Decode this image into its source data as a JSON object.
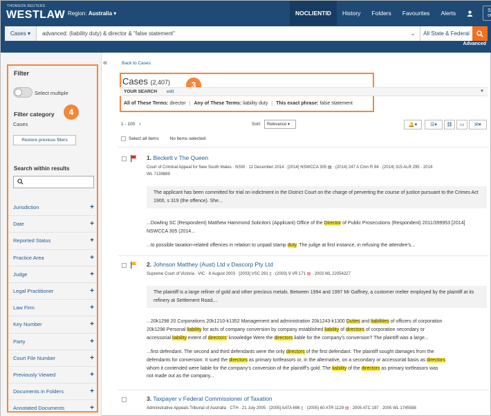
{
  "header": {
    "brand_top": "THOMSON REUTERS",
    "brand": "WESTLAW",
    "region_label": "Region:",
    "region_value": "Australia",
    "client_id": "NOCLIENTID",
    "nav": [
      "History",
      "Folders",
      "Favourites",
      "Alerts"
    ],
    "sign_out": "Sign out"
  },
  "search": {
    "scope": "Cases",
    "query": "advanced: (liability duty) & director & \"false statement\"",
    "jurisdiction": "All State & Federal",
    "advanced": "Advanced"
  },
  "sidebar": {
    "title": "Filter",
    "select_multiple": "Select multiple",
    "filter_category_title": "Filter category",
    "filter_category_value": "Cases",
    "restore": "Restore previous filters",
    "search_within": "Search within results",
    "facets": [
      "Jurisdiction",
      "Date",
      "Reported Status",
      "Practice Area",
      "Judge",
      "Legal Practitioner",
      "Law Firm",
      "Key Number",
      "Party",
      "Court File Number",
      "Previously Viewed",
      "Documents in Folders",
      "Annotated Documents"
    ],
    "badge": "4"
  },
  "main": {
    "back": "Back to Cases",
    "title": "Cases",
    "count": "(2,407)",
    "badge": "3",
    "your_search": "YOUR SEARCH",
    "edit": "edit",
    "terms": [
      {
        "label": "All of These Terms:",
        "value": "director"
      },
      {
        "label": "Any of These Terms:",
        "value": "liability duty"
      },
      {
        "label": "This exact phrase:",
        "value": "false statement"
      }
    ],
    "range": "1 - 100",
    "sort_label": "Sort:",
    "sort_value": "Relevance",
    "select_all": "Select all items",
    "none_selected": "No items selected"
  },
  "results": [
    {
      "num": "1.",
      "title": "Beckett v The Queen",
      "flag_color": "#d0312d",
      "meta_1": "Court of Criminal Appeal for New South Wales   ·   NSW   ·   12 December 2014   ·   [2014] NSWCCA 305",
      "meta_2": "·   (2014) 247 A Crim R 94   ·   (2014) 315 ALR 295   ·   2014",
      "meta_3": "WL 7139889",
      "s1": "The applicant has been committed for trial on indictment in the District Court on the charge of perverting the course of justice pursuant to the Crimes Act 1900, s 319 (the offence). She...",
      "s2a": "...Dowling SC (Respondent) Matthew Hammond Solicitors (Applicant) Office of the ",
      "s2b": "Director",
      "s2c": " of Public Prosecutions (Respondent) 2011/399953 [2014] NSWCCA 305 (2014...",
      "s3a": "...to possible taxation-related offences in relation to unpaid stamp ",
      "s3b": "duty",
      "s3c": ". The judge at first instance, in refusing the attendee's..."
    },
    {
      "num": "2.",
      "title": "Johnson Matthey (Aust) Ltd v Dascorp Pty Ltd",
      "flag_color": "#e8b820",
      "meta_1": "Supreme Court of Victoria   ·   VIC   ·   8 August 2003   ·   [2003] VSC 291",
      "meta_2": "·   (2003) 9 VR 171",
      "meta_3": "·   2003 WL 22054227",
      "s1": "The plaintiff is a large refiner of gold and other precious metals. Between 1994 and 1997 Mr Gaffney, a customer melter employed by the plaintiff at its refinery at Settlement Road,...",
      "s2_l1a": "...20k1298 20 Corporations 20k1210-k1352 Management and administration 20k1243-k1300 ",
      "s2_l1b": "Duties",
      "s2_l1c": " and ",
      "s2_l1d": "liabilities",
      "s2_l1e": " of officers of corporation",
      "s2_l2a": "20k1298 Personal ",
      "s2_l2b": "liability",
      "s2_l2c": " for acts of company conversion by company established ",
      "s2_l2d": "liability",
      "s2_l2e": " of ",
      "s2_l2f": "directors",
      "s2_l2g": " of corporation secondary or",
      "s2_l3a": "accessorial ",
      "s2_l3b": "liability",
      "s2_l3c": " extent of ",
      "s2_l3d": "directors",
      "s2_l3e": "' knowledge Were the ",
      "s2_l3f": "directors",
      "s2_l3g": " liable for the company's conversion? The plaintiff was a large...",
      "s3_l1a": "...first defendant. The second and third defendants were the only ",
      "s3_l1b": "directors",
      "s3_l1c": " of the first defendant. The plaintiff sought damages from the",
      "s3_l2a": "defendants for conversion. It sued the ",
      "s3_l2b": "directors",
      "s3_l2c": " as primary tortfeasors or, in the alternative, on a secondary or accessorial basis as ",
      "s3_l2d": "directors",
      "s3_l3a": "whom it contended were liable for the company's conversion of the plaintiff's gold. The ",
      "s3_l3b": "liability",
      "s3_l3c": " of the ",
      "s3_l3d": "directors",
      "s3_l3e": " as primary tortfeasors was",
      "s3_l4": "not made out as the company..."
    },
    {
      "num": "3.",
      "title": "Taxpayer v Federal Commissioner of Taxation",
      "meta_1": "Administrative Appeals Tribunal of Australia   ·   CTH   ·   21 July 2005   ·   [2005] AATA 696",
      "meta_2": "·   (2005) 60 ATR 1129",
      "meta_3": "·   2005 ATC 197   ·   2005 WL 1745588"
    }
  ],
  "colors": {
    "header": "#1e4a75",
    "accent": "#f07122",
    "callout": "#f0883a",
    "link": "#1e5a96",
    "highlight": "#ffeb3b"
  }
}
